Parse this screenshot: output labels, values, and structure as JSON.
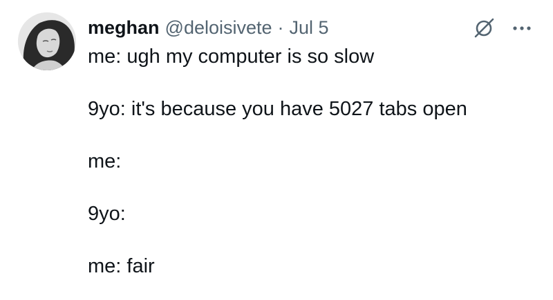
{
  "tweet": {
    "author": {
      "name": "meghan",
      "handle": "@deloisivete",
      "separator": "·",
      "date": "Jul 5"
    },
    "lines": [
      "me: ugh my computer is so slow",
      "9yo: it's because you have 5027 tabs open",
      "me:",
      "9yo:",
      "me: fair"
    ],
    "icons": {
      "grok": "grok-icon",
      "more": "more-options-icon"
    },
    "colors": {
      "text": "#0f1419",
      "secondary": "#536471"
    }
  }
}
